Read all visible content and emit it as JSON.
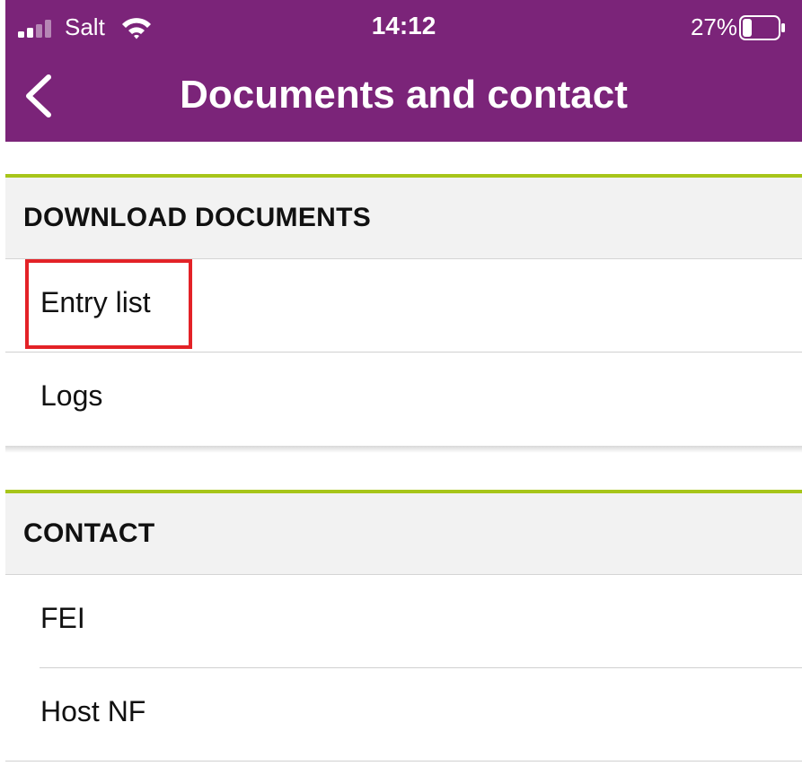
{
  "status_bar": {
    "carrier": "Salt",
    "time": "14:12",
    "battery_percent": "27%",
    "battery_level": 0.27,
    "icons": [
      "signal-icon",
      "wifi-icon",
      "battery-icon"
    ]
  },
  "nav": {
    "title": "Documents and contact",
    "back_icon": "chevron-left-icon"
  },
  "colors": {
    "header_bg": "#7b2479",
    "accent_line": "#a7c51a",
    "section_bg": "#f2f2f2",
    "highlight": "#e32227"
  },
  "sections": [
    {
      "title": "DOWNLOAD DOCUMENTS",
      "items": [
        {
          "label": "Entry list",
          "highlighted": true
        },
        {
          "label": "Logs",
          "highlighted": false
        }
      ]
    },
    {
      "title": "CONTACT",
      "items": [
        {
          "label": "FEI",
          "highlighted": false
        },
        {
          "label": "Host NF",
          "highlighted": false
        }
      ]
    }
  ]
}
